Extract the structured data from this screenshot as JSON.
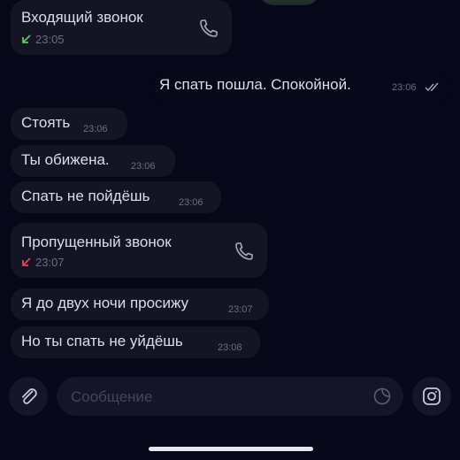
{
  "messages": {
    "incoming_call": {
      "title": "Входящий звонок",
      "time": "23:05",
      "arrow_color": "#5cc66b",
      "arrow_icon": "arrow-down-left-icon",
      "icon": "phone-icon"
    },
    "out_1": {
      "text": "Я спать пошла. Спокойной.",
      "time": "23:06",
      "status_icon": "double-check-icon"
    },
    "m1": {
      "text": "Стоять",
      "time": "23:06"
    },
    "m2": {
      "text": "Ты обижена.",
      "time": "23:06"
    },
    "m3": {
      "text": "Спать не пойдёшь",
      "time": "23:06"
    },
    "missed_call": {
      "title": "Пропущенный звонок",
      "time": "23:07",
      "arrow_color": "#e0455e",
      "arrow_icon": "arrow-down-left-icon",
      "icon": "phone-icon"
    },
    "m4": {
      "text": "Я до двух ночи просижу",
      "time": "23:07"
    },
    "m5": {
      "text": "Но ты спать не уйдёшь",
      "time": "23:08"
    }
  },
  "composer": {
    "placeholder": "Сообщение",
    "attach_icon": "paperclip-icon",
    "sticker_icon": "sticker-icon",
    "camera_icon": "camera-icon"
  }
}
